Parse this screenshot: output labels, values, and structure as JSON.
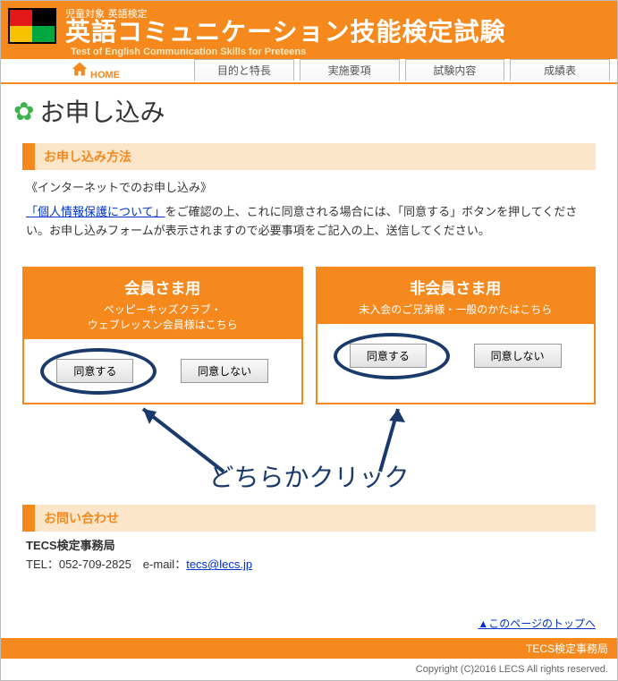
{
  "header": {
    "small_sub_1": "児童対象",
    "small_sub_2": "英語検定",
    "site_title": "英語コミュニケーション技能検定試験",
    "eng_sub": "Test of English Communication Skills for Preteens"
  },
  "nav": {
    "home": "HOME",
    "tabs": [
      "目的と特長",
      "実施要項",
      "試験内容",
      "成績表"
    ]
  },
  "page_title": "お申し込み",
  "section1": "お申し込み方法",
  "sub_heading": "《インターネットでのお申し込み》",
  "privacy_link": "「個人情報保護について」",
  "body_rest": "をご確認の上、これに同意される場合には、「同意する」ボタンを押してください。お申し込みフォームが表示されますので必要事項をご記入の上、送信してください。",
  "boxes": [
    {
      "title": "会員さま用",
      "sub": "ペッピーキッズクラブ・\nウェブレッスン会員様はこちら"
    },
    {
      "title": "非会員さま用",
      "sub": "未入会のご兄弟様・一般のかたはこちら"
    }
  ],
  "btn_agree": "同意する",
  "btn_disagree": "同意しない",
  "annotation": "どちらかクリック",
  "section2": "お問い合わせ",
  "contact": {
    "org": "TECS検定事務局",
    "line": "TEL：052-709-2825　e-mail：",
    "email": "tecs@lecs.jp"
  },
  "to_top": "▲このページのトップへ",
  "footer_bar": "TECS検定事務局",
  "copyright": "Copyright (C)2016 LECS All rights reserved."
}
